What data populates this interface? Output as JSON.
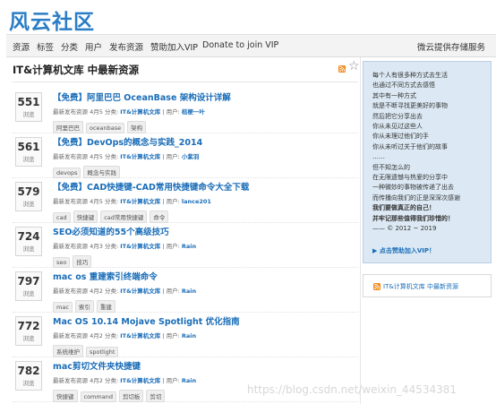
{
  "site": {
    "logo": "风云社区"
  },
  "nav": {
    "items": [
      "资源",
      "标签",
      "分类",
      "用户",
      "发布资源",
      "赞助加入VIP",
      "Donate to join VIP"
    ],
    "right": "微云提供存储服务"
  },
  "main": {
    "heading": "IT&计算机文库 中最新资源",
    "count_label": "浏览",
    "items": [
      {
        "count": "551",
        "title": "【免费】阿里巴巴 OceanBase 架构设计详解",
        "meta_prefix": "最新发布资源",
        "date": "4月5",
        "meta_mid": "分类:",
        "category": "IT&计算机文库",
        "meta_user_label": "| 用户:",
        "user": "桔梗一叶",
        "tags": [
          "阿里巴巴",
          "oceanbase",
          "架构"
        ]
      },
      {
        "count": "561",
        "title": "【免费】DevOps的概念与实践_2014",
        "meta_prefix": "最新发布资源",
        "date": "4月5",
        "meta_mid": "分类:",
        "category": "IT&计算机文库",
        "meta_user_label": "| 用户:",
        "user": "小紫羽",
        "tags": [
          "devops",
          "概念与实践"
        ]
      },
      {
        "count": "579",
        "title": "【免费】CAD快捷键-CAD常用快捷键命令大全下载",
        "meta_prefix": "最新发布资源",
        "date": "4月5",
        "meta_mid": "分类:",
        "category": "IT&计算机文库",
        "meta_user_label": "| 用户:",
        "user": "lance201",
        "tags": [
          "cad",
          "快捷键",
          "cad常用快捷键",
          "命令"
        ]
      },
      {
        "count": "724",
        "title": "SEO必须知道的55个高级技巧",
        "meta_prefix": "最新发布资源",
        "date": "4月3",
        "meta_mid": "分类:",
        "category": "IT&计算机文库",
        "meta_user_label": "| 用户:",
        "user": "Rain",
        "tags": [
          "seo",
          "技巧"
        ]
      },
      {
        "count": "797",
        "title": "mac os 重建索引终端命令",
        "meta_prefix": "最新发布资源",
        "date": "4月2",
        "meta_mid": "分类:",
        "category": "IT&计算机文库",
        "meta_user_label": "| 用户:",
        "user": "Rain",
        "tags": [
          "mac",
          "索引",
          "重建"
        ]
      },
      {
        "count": "772",
        "title": "Mac OS 10.14 Mojave Spotlight 优化指南",
        "meta_prefix": "最新发布资源",
        "date": "4月2",
        "meta_mid": "分类:",
        "category": "IT&计算机文库",
        "meta_user_label": "| 用户:",
        "user": "Rain",
        "tags": [
          "系统维护",
          "spotlight"
        ]
      },
      {
        "count": "782",
        "title": "mac剪切文件夹快捷键",
        "meta_prefix": "最新发布资源",
        "date": "4月2",
        "meta_mid": "分类:",
        "category": "IT&计算机文库",
        "meta_user_label": "| 用户:",
        "user": "Rain",
        "tags": [
          "快捷键",
          "command",
          "剪切板",
          "剪切"
        ]
      }
    ]
  },
  "sidebar": {
    "quote_lines": [
      "每个人有很多种方式去生活",
      "也通过不同方式去感悟",
      "其中有一种方式",
      "就是不断寻找更美好的事物",
      "然后把它分享出去",
      "你从未见过这些人",
      "你从未理过他们的手",
      "你从未听过关于他们的故事",
      "……",
      "但不知怎么的",
      "在无限遗憾与热爱的分享中",
      "一种微妙的事物被传递了出去",
      "而传播向我们的正是深深次感谢",
      "我们要做真正的自己！",
      "并牢记那些值得我们珍惜的！",
      "—— © 2012 ~ 2019"
    ],
    "bold_lines": [
      13,
      14
    ],
    "donate": "▶ 点击赞助加入VIP！",
    "rss_label": "IT&计算机文库 中最新资源"
  },
  "watermark": "https://blog.csdn.net/weixin_44534381",
  "colors": {
    "link": "#1a6db8",
    "logo": "#2a7ec6",
    "side_bg": "#dce9f4",
    "rss": "#f28a1a"
  }
}
